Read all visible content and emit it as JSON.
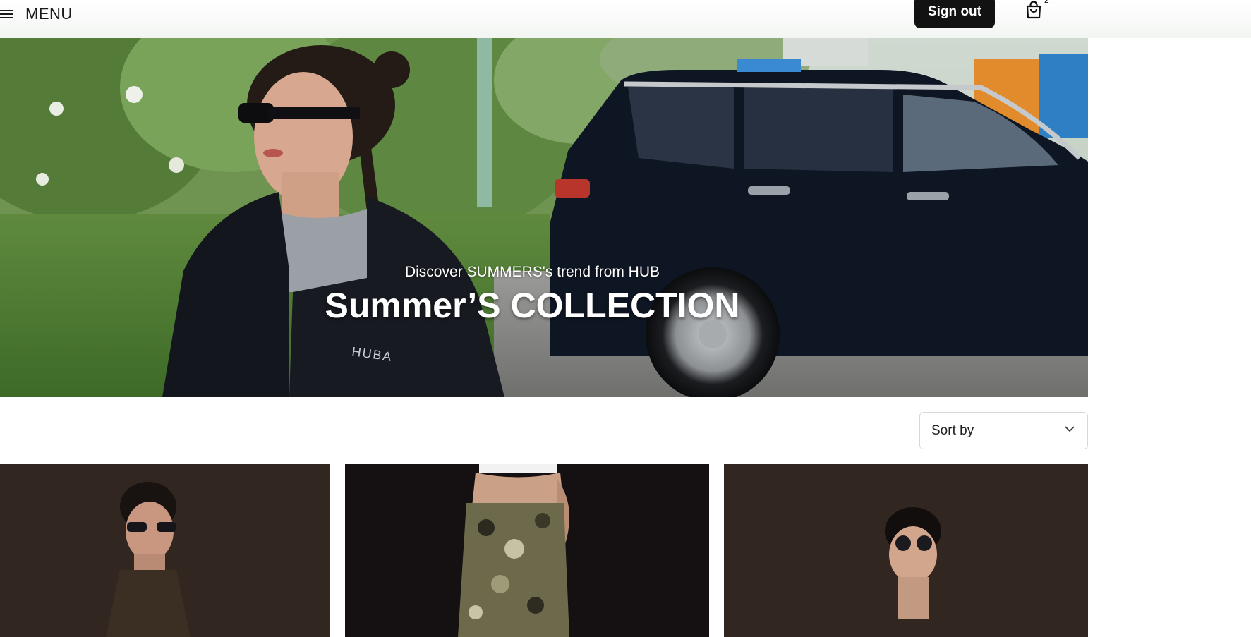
{
  "header": {
    "menu_label": "MENU",
    "sign_out_label": "Sign out",
    "cart_count": "2",
    "icons": [
      "hamburger-icon",
      "shopping-bag-icon"
    ]
  },
  "hero": {
    "subtitle": "Discover SUMMERS's trend from HUB",
    "title": "Summer’S COLLECTION",
    "jacket_text": "HUBA"
  },
  "sort": {
    "label": "Sort by",
    "icon": "chevron-down-icon"
  },
  "products": [
    {
      "image": "model in sunglasses and jacket"
    },
    {
      "image": "model in camo pants"
    },
    {
      "image": "model in round sunglasses"
    }
  ],
  "colors": {
    "button_bg": "#121212",
    "button_text": "#ffffff",
    "border": "#d8d8d8"
  }
}
